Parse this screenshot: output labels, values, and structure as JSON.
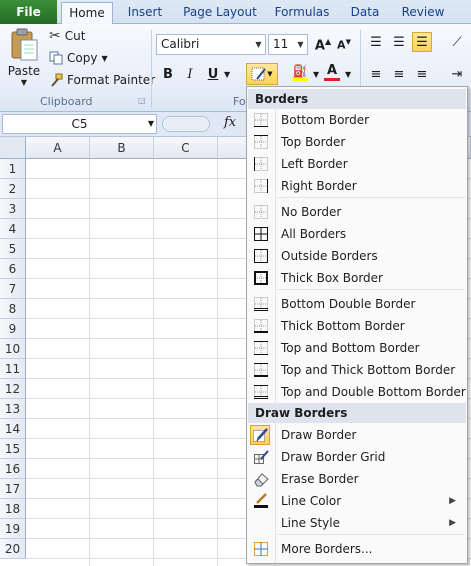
{
  "tabs": [
    {
      "label": "File"
    },
    {
      "label": "Home"
    },
    {
      "label": "Insert"
    },
    {
      "label": "Page Layout"
    },
    {
      "label": "Formulas"
    },
    {
      "label": "Data"
    },
    {
      "label": "Review"
    }
  ],
  "clipboard": {
    "paste": "Paste",
    "cut": "Cut",
    "copy": "Copy",
    "format_painter": "Format Painter",
    "group_label": "Clipboard"
  },
  "font": {
    "name": "Calibri",
    "size": "11",
    "group_label_partial": "Fo"
  },
  "formula_bar": {
    "name_box": "C5",
    "fx": "fx"
  },
  "grid": {
    "columns": [
      "A",
      "B",
      "C"
    ],
    "rows": [
      "1",
      "2",
      "3",
      "4",
      "5",
      "6",
      "7",
      "8",
      "9",
      "10",
      "11",
      "12",
      "13",
      "14",
      "15",
      "16",
      "17",
      "18",
      "19",
      "20"
    ]
  },
  "menu": {
    "borders_header": "Borders",
    "borders": [
      {
        "label": "Bottom Border",
        "icon": "bottom-border-icon"
      },
      {
        "label": "Top Border",
        "icon": "top-border-icon"
      },
      {
        "label": "Left Border",
        "icon": "left-border-icon"
      },
      {
        "label": "Right Border",
        "icon": "right-border-icon"
      },
      {
        "label": "No Border",
        "icon": "no-border-icon"
      },
      {
        "label": "All Borders",
        "icon": "all-borders-icon"
      },
      {
        "label": "Outside Borders",
        "icon": "outside-borders-icon"
      },
      {
        "label": "Thick Box Border",
        "icon": "thick-box-border-icon"
      },
      {
        "label": "Bottom Double Border",
        "icon": "bottom-double-border-icon"
      },
      {
        "label": "Thick Bottom Border",
        "icon": "thick-bottom-border-icon"
      },
      {
        "label": "Top and Bottom Border",
        "icon": "top-bottom-border-icon"
      },
      {
        "label": "Top and Thick Bottom Border",
        "icon": "top-thick-bottom-border-icon"
      },
      {
        "label": "Top and Double Bottom Border",
        "icon": "top-double-bottom-border-icon"
      }
    ],
    "draw_header": "Draw Borders",
    "draw": [
      {
        "label": "Draw Border",
        "icon": "pencil-border-icon"
      },
      {
        "label": "Draw Border Grid",
        "icon": "pencil-grid-icon"
      },
      {
        "label": "Erase Border",
        "icon": "eraser-icon"
      },
      {
        "label": "Line Color",
        "icon": "line-color-icon"
      },
      {
        "label": "Line Style",
        "icon": ""
      }
    ],
    "more": {
      "label": "More Borders...",
      "icon": "more-borders-icon"
    }
  },
  "colors": {
    "file_tab": "#2a7a2a",
    "accent": "#15428b",
    "highlight": "#ffd15a",
    "font_color_bar": "#e02020",
    "fill_color_bar": "#ffff00"
  }
}
